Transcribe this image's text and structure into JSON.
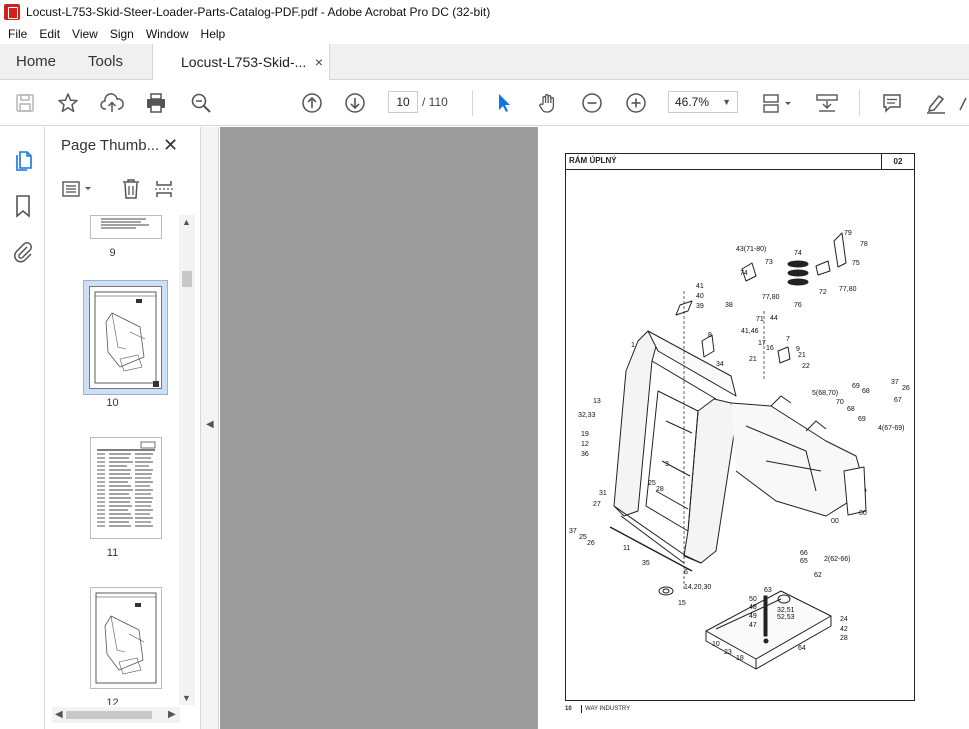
{
  "window": {
    "title": "Locust-L753-Skid-Steer-Loader-Parts-Catalog-PDF.pdf - Adobe Acrobat Pro DC (32-bit)"
  },
  "menu": [
    "File",
    "Edit",
    "View",
    "Sign",
    "Window",
    "Help"
  ],
  "tabs": {
    "home": "Home",
    "tools": "Tools",
    "document": "Locust-L753-Skid-...",
    "close": "×"
  },
  "toolbar": {
    "current_page": "10",
    "total_pages": "/ 110",
    "zoom": "46.7%"
  },
  "panel": {
    "title": "Page Thumb...",
    "close": "✕",
    "thumbnails": [
      {
        "label": "9"
      },
      {
        "label": "10",
        "selected": true
      },
      {
        "label": "11"
      },
      {
        "label": "12"
      }
    ]
  },
  "document": {
    "section_title": "RÁM ÚPLNÝ",
    "section_number": "02",
    "page_number": "10",
    "company": "WAY INDUSTRY",
    "callouts": [
      "43(71-80)",
      "79",
      "78",
      "74",
      "73",
      "75",
      "74",
      "77,80",
      "72",
      "77,80",
      "76",
      "41",
      "40",
      "39",
      "38",
      "44",
      "71",
      "8",
      "41,46",
      "17",
      "16",
      "7",
      "9",
      "21",
      "21",
      "22",
      "34",
      "1",
      "5(68,70)",
      "69",
      "68",
      "37",
      "26",
      "67",
      "70",
      "68",
      "69",
      "4(67-69)",
      "13",
      "32,33",
      "19",
      "12",
      "36",
      "3",
      "25",
      "28",
      "31",
      "27",
      "37",
      "25",
      "26",
      "11",
      "35",
      "6",
      "14,20,30",
      "15",
      "00",
      "00",
      "66",
      "65",
      "2(62-66)",
      "62",
      "63",
      "50",
      "48",
      "49",
      "47",
      "32,51",
      "52,53",
      "24",
      "42",
      "28",
      "10",
      "23",
      "18",
      "64"
    ]
  },
  "colors": {
    "accent": "#1473e6",
    "doc_bg": "#9d9d9d",
    "selection": "#cfe0f4"
  }
}
